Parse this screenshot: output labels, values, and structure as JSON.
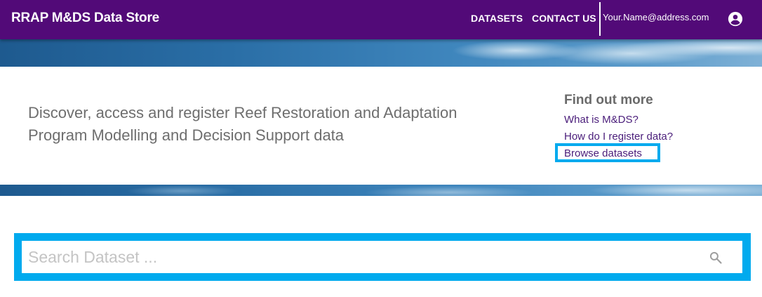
{
  "header": {
    "brand": "RRAP M&DS Data Store",
    "nav": {
      "datasets": "DATASETS",
      "contact": "CONTACT US"
    },
    "user_email": "Your.Name@address.com",
    "account_icon": "account-circle-icon"
  },
  "hero": {
    "tagline": "Discover, access and register Reef Restoration and Adaptation Program Modelling and Decision Support data",
    "find_out_more": {
      "title": "Find out more",
      "links": [
        "What is M&DS?",
        "How do I register data?",
        "Browse datasets"
      ]
    }
  },
  "search": {
    "placeholder": "Search Dataset ...",
    "value": "",
    "icon": "search-icon"
  },
  "colors": {
    "appbar": "#520a78",
    "link": "#4a1d7a",
    "highlight": "#00aaee"
  }
}
